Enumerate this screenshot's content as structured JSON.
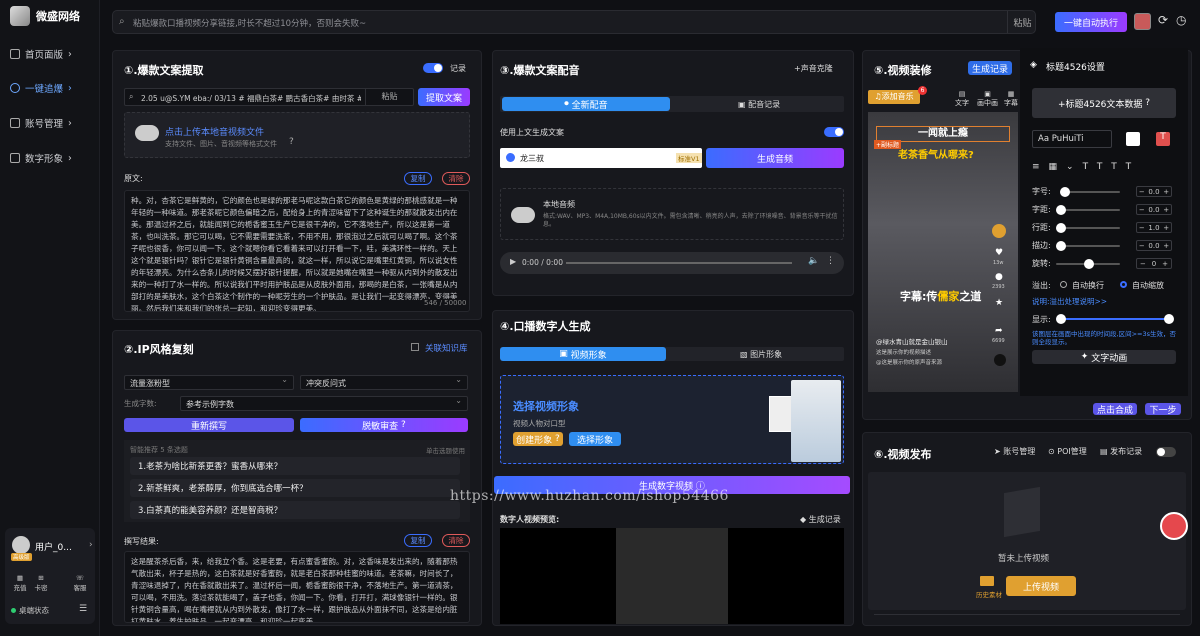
{
  "app": {
    "name": "微盛网络"
  },
  "nav": [
    {
      "label": "首页面版"
    },
    {
      "label": "一键追爆"
    },
    {
      "label": "账号管理"
    },
    {
      "label": "数字形象"
    }
  ],
  "user": {
    "name": "用户_0...",
    "badge": "高级版",
    "status": "桌端状态",
    "actions": [
      "充值",
      "卡密",
      "客服"
    ]
  },
  "topbar": {
    "placeholder": "粘贴爆款口播视频分享链接,时长不超过10分钟，否则会失败~",
    "paste": "粘贴",
    "auto": "一键自动执行"
  },
  "p1": {
    "title": "①.爆款文案提取",
    "record": "记录",
    "link": "2.05 u@S.YM eba:/ 03/13 # 福鼎白茶# 鹏古香白茶# 由时茶 # 白毫",
    "paste": "粘贴",
    "extract": "提取文案",
    "upload_title": "点击上传本地音视频文件",
    "upload_sub": "支持文件、图片、音视频等格式文件",
    "orig_label": "原文:",
    "copy": "复制",
    "clear": "清除",
    "orig_text": "种。对，杏茶它是鲜黄的，它的颜色也是绿的那老马呢这款白茶它的颜色是黄绿的那桃感就是一种年轻的一种味道。那老茶呢它颜色偏暗之后，配给身上的青涩味留下了这种诞生的那就散发出内在美。那温过杯之后，就能闻到它的栀香蜜玉生产它是很干净的，它不落地生产，所以这是第一道茶，也叫洗茶。那它可以喝，它不需要需要洗茶，不用不用，那很泡过之后就可以喝了啊。这个茶子呢也很香，你可以闻一下。这个就嗯你看它看着来可以打开看一下，哇，美满环性一样的。天上这个就是银针吗？银针它是银针黄铜含量最高的，就这一样，所以说它是嘴里红黄铜，所以说女性的年轻漂亮。为什么杏条儿的时候又摆好银针提醒，所以就是她嘴在嘴里一种驱从内到外的散发出来的一种打了水一样的。所以说我们平时用护肤品是从皮肤外面用，那喝的是白茶，一张嘴是从内部打的是美肤水，这个白茶这个制作的一种呢劳生的一个护肤品。是让我们一起变得漂亮，变得美丽。然后我们来和我们的张总一起知，和迎珍变得更美。",
    "orig_count": "546 / 50000"
  },
  "p2": {
    "title": "②.IP风格复刻",
    "kb": "关联知识库",
    "opt1": "流量涨粉型",
    "opt2": "冲突反问式",
    "words_label": "生成字数:",
    "words": "参考示例字数",
    "rewrite": "重新撰写",
    "review": "脱敏审查",
    "hot_label": "智能推荐 5 条选题",
    "hot_right": "单击选题使用",
    "items": [
      "1.老茶为啥比新茶更香？蜜香从哪来？",
      "2.新茶鲜爽，老茶醇厚，你到底选合哪一杯？",
      "3.白茶真的能美容养颜？还是智商税？"
    ],
    "result_label": "撰写结果:",
    "copy": "复制",
    "clear": "清除",
    "result_text": "这是醒茶杀后香，来，给我立个香。这是老要，有点蜜香蜜韵。对，这香味是发出来的，随着那热气散出来，杯子是热的，这白茶就是好香蜜韵，就是老白茶那种桂蜜的味道。老茶嘛，时间长了，青涩味退掉了，内在香就散出来了。温过杯后一闻，栀香蜜韵很干净，不落地生产。第一道清茶，可以喝，不用洗。落过茶就能喝了，盖子也香，你闻一下。你看，打开打，满球像银针一样的。银针黄铜含量高，喝在嘴裡就从内到外散发，像打了水一样，跟护肤品从外面抹不同，这茶是给内脏打黄肤水。养生护肤品，一起变漂亮，和迎珍一起变美。"
  },
  "p3": {
    "title": "③.爆款文案配音",
    "clone": "+声音克隆",
    "tab1": "全新配音",
    "tab2": "配音记录",
    "use_above": "使用上文生成文案",
    "voice": "龙三叔",
    "voice_tag": "标准V1",
    "gen_audio": "生成音频",
    "local_title": "本地音频",
    "local_sub": "格式:WAV、MP3、M4A,10MB,60s以内文件。需包含清晰、稍亮的人声，去除了环境噪音、背景音乐等干扰信息。",
    "time": "0:00 / 0:00"
  },
  "p4": {
    "title": "④.口播数字人生成",
    "tab1": "视频形象",
    "tab2": "图片形象",
    "select_title": "选择视频形象",
    "select_sub": "视频人物对口型",
    "create": "创建形象",
    "choose": "选择形象",
    "gen": "生成数字视频",
    "preview_label": "数字人视频预览:",
    "records": "生成记录"
  },
  "p5": {
    "title": "⑤.视频装修",
    "gen_record": "生成记录",
    "add_music": "添加音乐",
    "badge": "6",
    "tools": [
      "文字",
      "画中画",
      "字幕"
    ],
    "caption1": "一闻就上瘾",
    "caption2": "老茶香气从哪来?",
    "tag": "+副标题",
    "subtitle_a": "字幕:传",
    "subtitle_b": "儒家",
    "subtitle_c": "之道",
    "meta1": "@绿水青山就是金山银山",
    "meta2": "这是展示你的视频描述",
    "meta3": "@这是展示你的原声音来源",
    "likes": "13w",
    "stars": "2393",
    "shares": "6699",
    "synth": "点击合成",
    "next": "下一步"
  },
  "settings": {
    "title": "标题4526设置",
    "add_data": "+标题4526文本数据",
    "font": "PuHuiTi",
    "rows": [
      {
        "label": "字号:",
        "value": "0.0"
      },
      {
        "label": "字距:",
        "value": "0.0"
      },
      {
        "label": "行距:",
        "value": "1.0"
      },
      {
        "label": "描边:",
        "value": "0.0"
      },
      {
        "label": "旋转:",
        "value": "0"
      }
    ],
    "overflow": "溢出:",
    "auto_wrap": "自动换行",
    "auto_scale": "自动缩放",
    "note1": "说明:溢出处理说明>>",
    "show": "显示:",
    "note2": "该图层在画面中出现的时间段,区间>=3s生效，否则全段显示。",
    "anim": "文字动画"
  },
  "p6": {
    "title": "⑥.视频发布",
    "acct": "账号管理",
    "poi": "POI管理",
    "history": "发布记录",
    "empty": "暂未上传视频",
    "material": "历史素材",
    "upload": "上传视频"
  },
  "watermark": "https://www.huzhan.com/ishop54466"
}
